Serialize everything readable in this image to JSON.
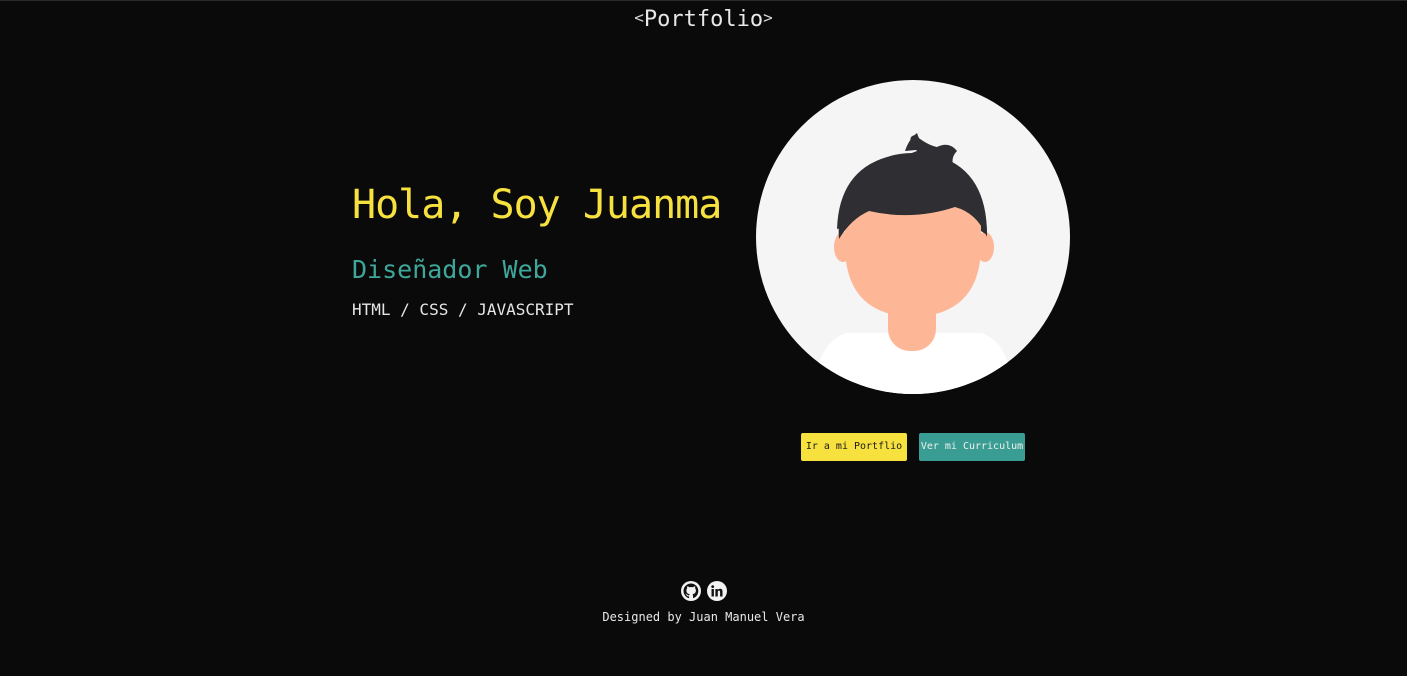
{
  "header": {
    "brand_left": "<",
    "brand_title": "Portfolio",
    "brand_right": ">"
  },
  "hero": {
    "greeting": "Hola, Soy Juanma",
    "role": "Diseñador Web",
    "stack": "HTML / CSS / JAVASCRIPT",
    "avatar_icon": "person-avatar-icon"
  },
  "actions": {
    "portfolio_label": "Ir a mi Portflio",
    "cv_label": "Ver mi Curriculum"
  },
  "footer": {
    "github_icon": "github-icon",
    "linkedin_icon": "linkedin-icon",
    "credit": "Designed by Juan Manuel Vera"
  },
  "colors": {
    "background": "#0a0a0a",
    "accent_yellow": "#f7e13f",
    "accent_teal": "#3fa79a"
  }
}
